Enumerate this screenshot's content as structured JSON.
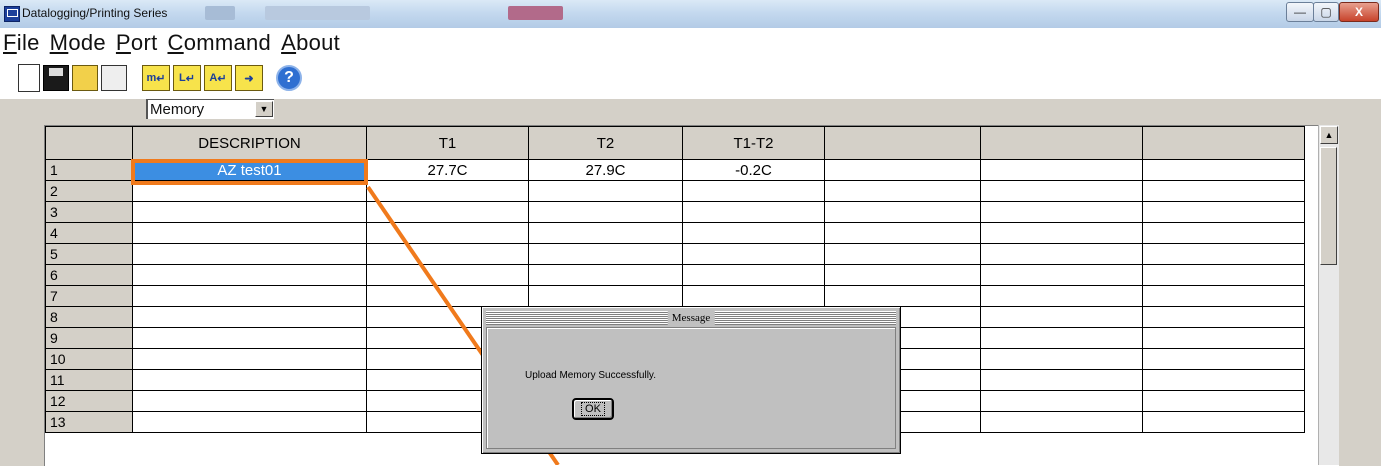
{
  "window": {
    "title": "Datalogging/Printing Series",
    "minimize": "—",
    "restore": "▢",
    "close": "X"
  },
  "menu": [
    {
      "label_ul": "F",
      "label_rest": "ile"
    },
    {
      "label_ul": "M",
      "label_rest": "ode"
    },
    {
      "label_ul": "P",
      "label_rest": "ort"
    },
    {
      "label_ul": "C",
      "label_rest": "ommand"
    },
    {
      "label_ul": "A",
      "label_rest": "bout"
    }
  ],
  "toolbar": {
    "icons": [
      "new-file-icon",
      "save-icon",
      "open-folder-icon",
      "print-icon",
      "memory-mode-icon",
      "logger-mode-icon",
      "alarm-mode-icon",
      "export-folder-icon",
      "help-icon"
    ],
    "memory_mode_glyph": "m",
    "logger_mode_glyph": "L",
    "alarm_mode_glyph": "A",
    "help_glyph": "?"
  },
  "mode_select": {
    "value": "Memory"
  },
  "grid": {
    "columns": [
      "DESCRIPTION",
      "T1",
      "T2",
      "T1-T2",
      "",
      "",
      ""
    ],
    "rows": [
      {
        "num": "1",
        "cells": [
          "AZ test01",
          "27.7C",
          "27.9C",
          "-0.2C",
          "",
          "",
          ""
        ]
      },
      {
        "num": "2",
        "cells": [
          "",
          "",
          "",
          "",
          "",
          "",
          ""
        ]
      },
      {
        "num": "3",
        "cells": [
          "",
          "",
          "",
          "",
          "",
          "",
          ""
        ]
      },
      {
        "num": "4",
        "cells": [
          "",
          "",
          "",
          "",
          "",
          "",
          ""
        ]
      },
      {
        "num": "5",
        "cells": [
          "",
          "",
          "",
          "",
          "",
          "",
          ""
        ]
      },
      {
        "num": "6",
        "cells": [
          "",
          "",
          "",
          "",
          "",
          "",
          ""
        ]
      },
      {
        "num": "7",
        "cells": [
          "",
          "",
          "",
          "",
          "",
          "",
          ""
        ]
      },
      {
        "num": "8",
        "cells": [
          "",
          "",
          "",
          "",
          "",
          "",
          ""
        ]
      },
      {
        "num": "9",
        "cells": [
          "",
          "",
          "",
          "",
          "",
          "",
          ""
        ]
      },
      {
        "num": "10",
        "cells": [
          "",
          "",
          "",
          "",
          "",
          "",
          ""
        ]
      },
      {
        "num": "11",
        "cells": [
          "",
          "",
          "",
          "",
          "",
          "",
          ""
        ]
      },
      {
        "num": "12",
        "cells": [
          "",
          "",
          "",
          "",
          "",
          "",
          ""
        ]
      },
      {
        "num": "13",
        "cells": [
          "",
          "",
          "",
          "",
          "",
          "",
          ""
        ]
      }
    ]
  },
  "dialog": {
    "title": "Message",
    "message": "Upload Memory Successfully.",
    "ok_label": "OK"
  },
  "colors": {
    "highlight": "#f07a1c",
    "selected_cell": "#3c8ee2"
  }
}
